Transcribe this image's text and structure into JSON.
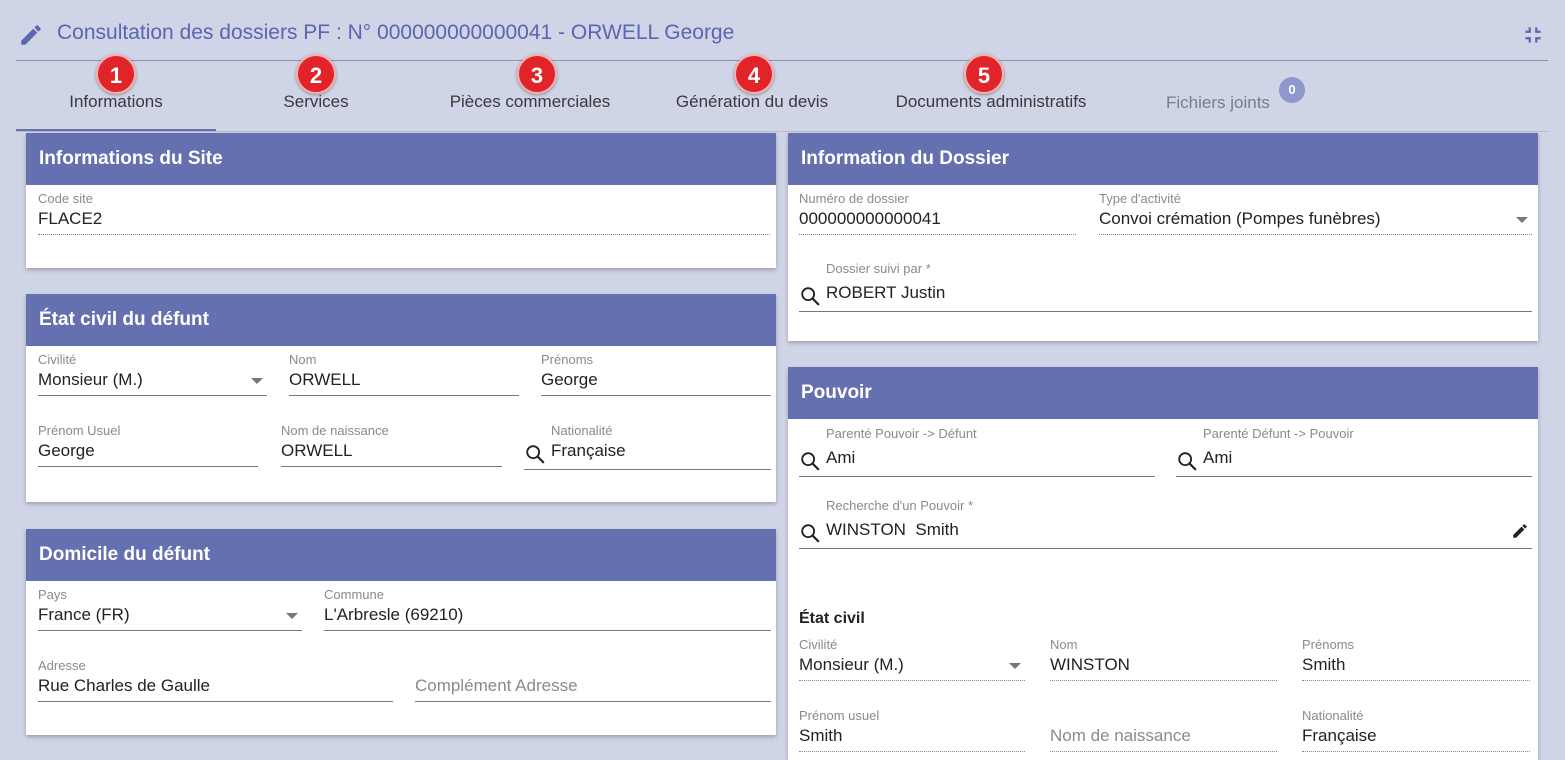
{
  "header": {
    "title": "Consultation des dossiers PF : N° 000000000000041 - ORWELL George",
    "edit_icon": "pencil-icon",
    "collapse_icon": "collapse-icon"
  },
  "tabs": [
    {
      "label": "Informations",
      "step": "1",
      "active": true
    },
    {
      "label": "Services",
      "step": "2"
    },
    {
      "label": "Pièces commerciales",
      "step": "3"
    },
    {
      "label": "Génération du devis",
      "step": "4"
    },
    {
      "label": "Documents administratifs",
      "step": "5"
    },
    {
      "label": "Fichiers joints",
      "count": "0"
    }
  ],
  "site": {
    "title": "Informations du Site",
    "code_label": "Code site",
    "code_value": "FLACE2"
  },
  "etat_civil": {
    "title": "État civil du défunt",
    "civilite_label": "Civilité",
    "civilite_value": "Monsieur (M.)",
    "nom_label": "Nom",
    "nom_value": "ORWELL",
    "prenoms_label": "Prénoms",
    "prenoms_value": "George",
    "prenom_usuel_label": "Prénom Usuel",
    "prenom_usuel_value": "George",
    "nom_naissance_label": "Nom de naissance",
    "nom_naissance_value": "ORWELL",
    "nationalite_label": "Nationalité",
    "nationalite_value": "Française"
  },
  "domicile": {
    "title": "Domicile du défunt",
    "pays_label": "Pays",
    "pays_value": "France (FR)",
    "commune_label": "Commune",
    "commune_value": "L'Arbresle (69210)",
    "adresse_label": "Adresse",
    "adresse_value": "Rue Charles de Gaulle",
    "complement_placeholder": "Complément Adresse"
  },
  "dossier": {
    "title": "Information du Dossier",
    "numero_label": "Numéro de dossier",
    "numero_value": "000000000000041",
    "type_label": "Type d'activité",
    "type_value": "Convoi crémation (Pompes funèbres)",
    "suivi_label": "Dossier suivi par *",
    "suivi_value": "ROBERT Justin"
  },
  "pouvoir": {
    "title": "Pouvoir",
    "parente_pd_label": "Parenté Pouvoir -> Défunt",
    "parente_pd_value": "Ami",
    "parente_dp_label": "Parenté Défunt -> Pouvoir",
    "parente_dp_value": "Ami",
    "recherche_label": "Recherche d'un Pouvoir *",
    "recherche_value": "WINSTON  Smith",
    "etat_civil_heading": "État civil",
    "civilite_label": "Civilité",
    "civilite_value": "Monsieur (M.)",
    "nom_label": "Nom",
    "nom_value": "WINSTON",
    "prenoms_label": "Prénoms",
    "prenoms_value": "Smith",
    "prenom_usuel_label": "Prénom usuel",
    "prenom_usuel_value": "Smith",
    "nom_naissance_placeholder": "Nom de naissance",
    "nationalite_label": "Nationalité",
    "nationalite_value": "Française"
  },
  "colors": {
    "accent": "#6470b0",
    "step_badge": "#e0242a",
    "background": "#cfd4e6"
  }
}
